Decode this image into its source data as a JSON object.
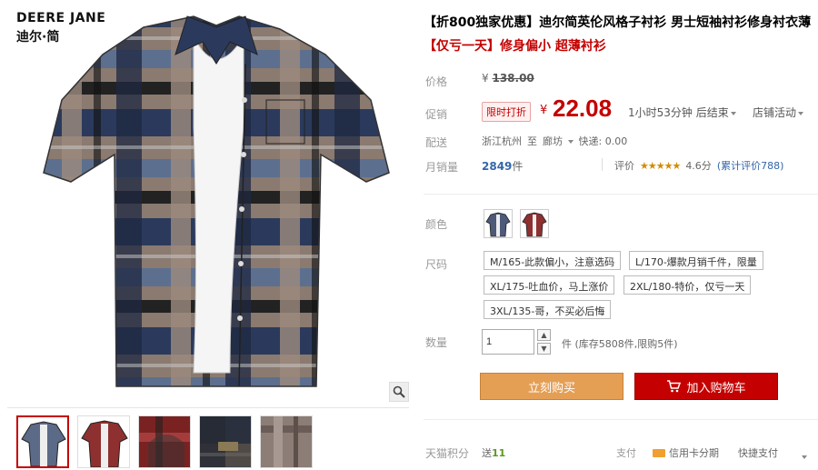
{
  "brand": {
    "name_en": "DEERE JANE",
    "name_cn": "迪尔·简"
  },
  "product": {
    "title": "【折800独家优惠】迪尔简英伦风格子衬衫 男士短袖衬衫修身衬衣薄",
    "subtitle": "【仅亏一天】修身偏小 超薄衬衫"
  },
  "labels": {
    "price": "价格",
    "promo": "促销",
    "shipping": "配送",
    "monthly_sales": "月销量",
    "color": "颜色",
    "size": "尺码",
    "quantity": "数量",
    "points": "天猫积分",
    "payment": "支付"
  },
  "price": {
    "currency": "¥",
    "original": "138.00",
    "promo_tag": "限时打折",
    "current": "22.08",
    "countdown": "1小时53分钟",
    "ends_label": "后结束",
    "shop_activity": "店铺活动"
  },
  "shipping": {
    "from": "浙江杭州",
    "to_label": "至",
    "dest": "廊坊",
    "express": "快递: 0.00"
  },
  "sales": {
    "count": "2849",
    "unit": "件",
    "rating_label": "评价",
    "stars": "★★★★★",
    "score": "4.6分",
    "reviews": "(累计评价788)"
  },
  "sizes": [
    "M/165-此款偏小，注意选码",
    "L/170-爆款月销千件，限量",
    "XL/175-吐血价，马上涨价",
    "2XL/180-特价，仅亏一天",
    "3XL/135-哥，不买必后悔"
  ],
  "quantity": {
    "value": "1",
    "stock": "件 (库存5808件,限购5件)"
  },
  "buttons": {
    "buy_now": "立刻购买",
    "add_to_cart": "加入购物车"
  },
  "points": {
    "prefix": "送",
    "value": "11"
  },
  "payment": {
    "card": "信用卡分期",
    "quick": "快捷支付"
  },
  "colors": {
    "accent": "#c40000",
    "buy_button": "#e59f55",
    "link": "#3366aa",
    "stars": "#d38c00"
  },
  "icons": [
    "magnifier-icon",
    "cart-icon",
    "caret-down-icon",
    "credit-card-icon",
    "arrow-up-icon",
    "arrow-down-icon"
  ]
}
